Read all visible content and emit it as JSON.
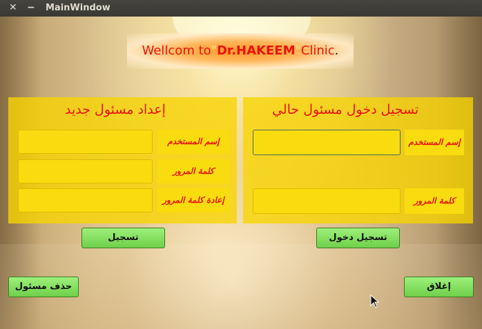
{
  "window": {
    "title": "MainWindow"
  },
  "banner": {
    "prefix": "Wellcom to",
    "quote_open": "\"",
    "name": "Dr.HAKEEM",
    "quote_close": "\"",
    "suffix": "Clinic",
    "period": "."
  },
  "new_admin": {
    "title": "إعداد مسئول جديد",
    "username_label": "إسم المستخدم",
    "password_label": "كلمة المرور",
    "confirm_label": "إعادة كلمة المرور",
    "username_value": "",
    "password_value": "",
    "confirm_value": "",
    "register_button": "تسجيل"
  },
  "login": {
    "title": "تسجيل دخول مسئول حالي",
    "username_label": "إسم المستخدم",
    "password_label": "كلمة المرور",
    "username_value": "",
    "password_value": "",
    "login_button": "تسجيل دخول"
  },
  "footer": {
    "delete_button": "حذف مسئول",
    "close_button": "إغلاق"
  },
  "colors": {
    "panel": "#f7d500",
    "field": "#f9dc0f",
    "label_text": "#e8140e",
    "button": "#7fdf5a"
  }
}
